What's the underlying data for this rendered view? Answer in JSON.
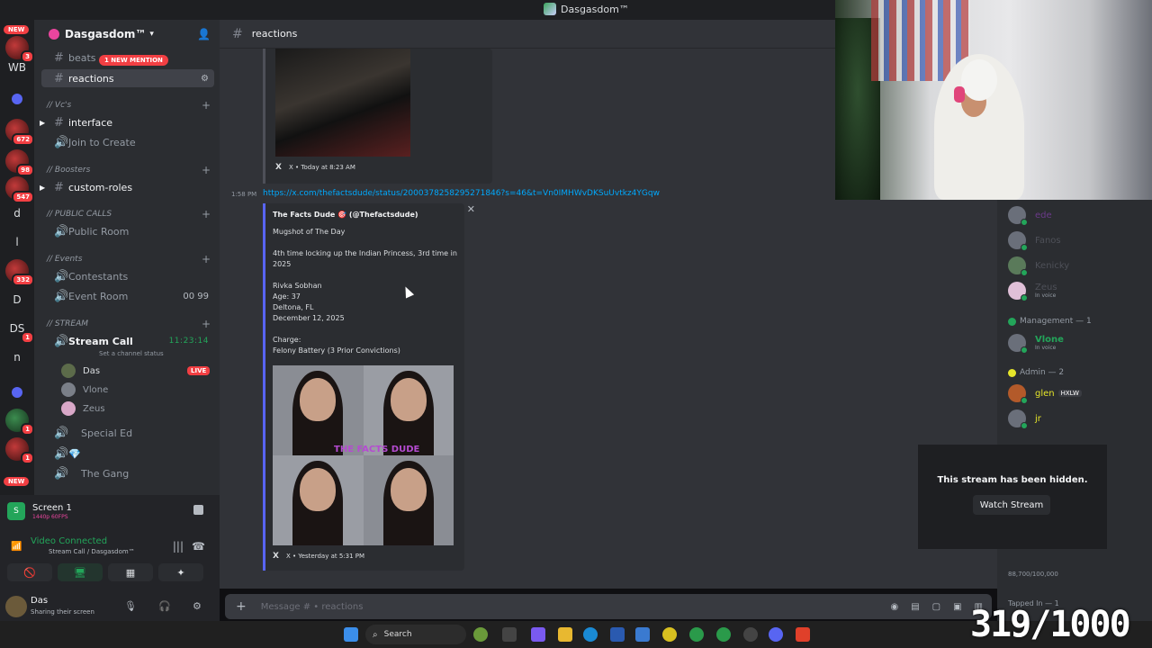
{
  "window": {
    "title": "Dasgasdom™"
  },
  "rail": {
    "new_top": "NEW",
    "new_bottom": "NEW",
    "items": [
      {
        "text": "",
        "badge": "3"
      },
      {
        "text": "WB",
        "badge": ""
      },
      {
        "text": "",
        "badge": "672"
      },
      {
        "text": "",
        "badge": "98"
      },
      {
        "text": "",
        "badge": "547"
      },
      {
        "text": "d",
        "badge": ""
      },
      {
        "text": "l",
        "badge": ""
      },
      {
        "text": "",
        "badge": "332"
      },
      {
        "text": "D",
        "badge": ""
      },
      {
        "text": "DS",
        "badge": "1"
      },
      {
        "text": "n",
        "badge": ""
      },
      {
        "text": "",
        "badge": "1"
      },
      {
        "text": "",
        "badge": "1"
      }
    ]
  },
  "guild": {
    "name": "Dasgasdom™"
  },
  "sidebar": {
    "mention_pill": "1 NEW MENTION",
    "channels": {
      "beats": "beats",
      "reactions": "reactions",
      "cat_vcs": "// Vc's",
      "interface": "interface",
      "join_to_create": "Join to Create",
      "cat_boosters": "// Boosters",
      "custom_roles": "custom-roles",
      "cat_public_calls": "// PUBLIC CALLS",
      "public_room": "Public Room",
      "cat_events": "// Events",
      "contestants": "Contestants",
      "event_room": "Event Room",
      "event_room_count_a": "00",
      "event_room_count_b": "99",
      "cat_stream": "// STREAM",
      "stream_call": "Stream Call",
      "stream_timer": "11:23:14",
      "set_status": "Set a channel status",
      "special_ed": "Special Ed",
      "the_gang": "The Gang"
    },
    "voice_users": [
      {
        "name": "Das",
        "live": "LIVE"
      },
      {
        "name": "Vlone"
      },
      {
        "name": "Zeus"
      }
    ]
  },
  "screen_share": {
    "title": "Screen 1",
    "quality": "1440p 60FPS"
  },
  "voice": {
    "status": "Video Connected",
    "channel": "Stream Call / Dasgasdom™"
  },
  "user": {
    "name": "Das",
    "status": "Sharing their screen"
  },
  "chat": {
    "channel": "reactions",
    "embed1_footer": "X • Today at 8:23 AM",
    "timestamp": "1:58 PM",
    "link": "https://x.com/thefactsdude/status/2000378258295271846?s=46&t=Vn0IMHWvDKSuUvtkz4YGqw",
    "embed2": {
      "author": "The Facts Dude 🎯 (@Thefactsdude)",
      "description": "Mugshot of The Day\n\n4th time locking up the Indian Princess, 3rd time in 2025\n\nRivka Sobhan\nAge: 37\nDeltona, FL\nDecember 12, 2025\n\nCharge:\nFelony Battery (3 Prior Convictions)",
      "watermark": "THE FACTS DUDE",
      "footer": "X • Yesterday at 5:31 PM"
    },
    "composer_placeholder": "Message # • reactions"
  },
  "members": {
    "top": [
      {
        "name": "ede",
        "sub": ""
      },
      {
        "name": "Fanos",
        "sub": ""
      },
      {
        "name": "Kenicky",
        "sub": ""
      },
      {
        "name": "Zeus",
        "sub": "In voice"
      }
    ],
    "management_header": "Management — 1",
    "management": [
      {
        "name": "Vlone",
        "sub": "In voice"
      }
    ],
    "admin_header": "Admin — 2",
    "admin": [
      {
        "name": "glen",
        "tag": "HXLW"
      },
      {
        "name": "jr"
      }
    ],
    "hidden_msg": "This stream has been hidden.",
    "watch_button": "Watch Stream",
    "partial_count": "88,700/100,000",
    "tapped_in": "Tapped In — 1"
  },
  "taskbar": {
    "search_label": "Search"
  },
  "overlay": {
    "counter": "319/1000"
  },
  "colors": {
    "accent": "#5865f2",
    "danger": "#f23f43",
    "online": "#23a55a"
  }
}
